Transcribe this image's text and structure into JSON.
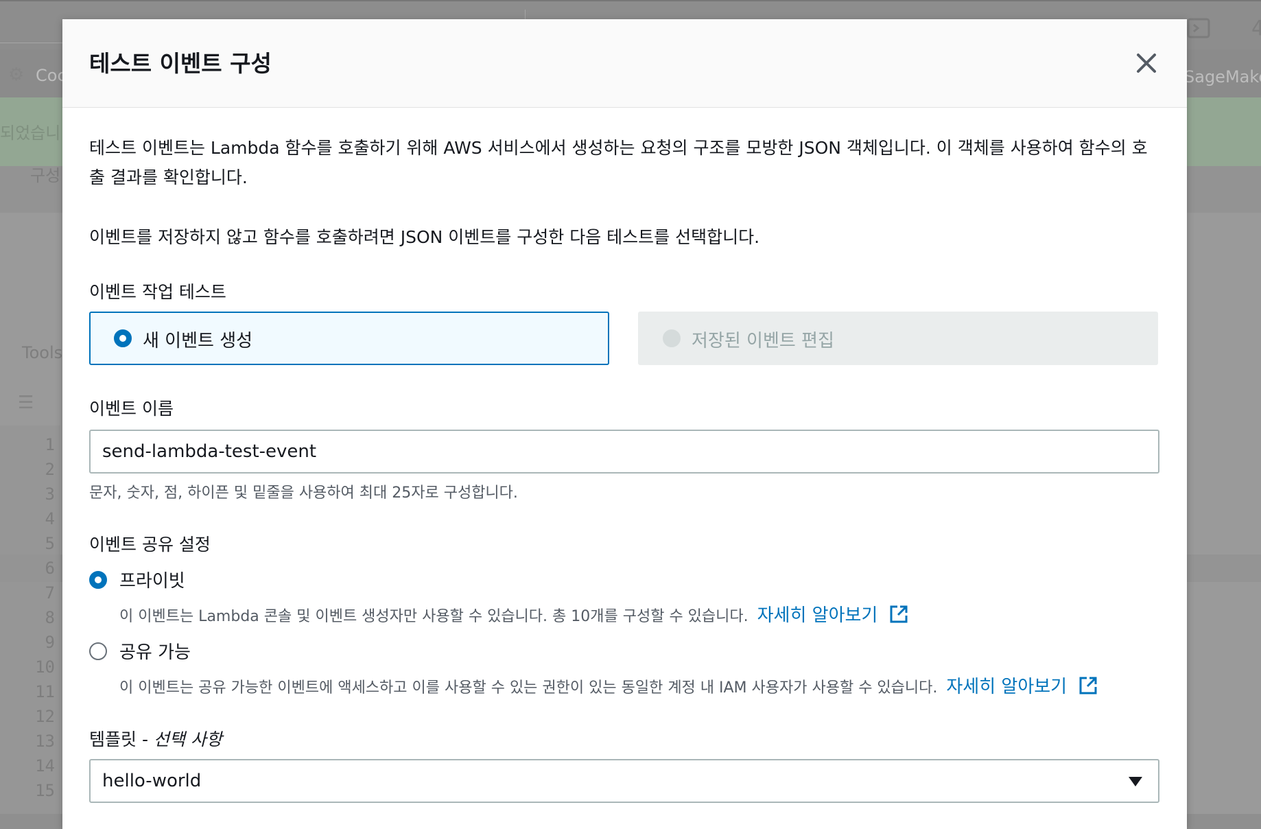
{
  "background": {
    "nav_left": "Coc",
    "nav_right": "SageMake",
    "banner_fragment": "되었습니",
    "tab_fragment": "구성",
    "tools_label": "Tools",
    "line_numbers": [
      "1",
      "2",
      "3",
      "4",
      "5",
      "6",
      "7",
      "8",
      "9",
      "10",
      "11",
      "12",
      "13",
      "14",
      "15"
    ],
    "top_right_fragment": "4"
  },
  "modal": {
    "title": "테스트 이벤트 구성",
    "intro": "테스트 이벤트는 Lambda 함수를 호출하기 위해 AWS 서비스에서 생성하는 요청의 구조를 모방한 JSON 객체입니다. 이 객체를 사용하여 함수의 호출 결과를 확인합니다.",
    "instruction": "이벤트를 저장하지 않고 함수를 호출하려면 JSON 이벤트를 구성한 다음 테스트를 선택합니다.",
    "action_label": "이벤트 작업 테스트",
    "action_options": [
      {
        "label": "새 이벤트 생성",
        "selected": true
      },
      {
        "label": "저장된 이벤트 편집",
        "selected": false,
        "disabled": true
      }
    ],
    "event_name_label": "이벤트 이름",
    "event_name_value": "send-lambda-test-event",
    "event_name_hint": "문자, 숫자, 점, 하이픈 및 밑줄을 사용하여 최대 25자로 구성합니다.",
    "sharing_label": "이벤트 공유 설정",
    "sharing_options": [
      {
        "label": "프라이빗",
        "selected": true,
        "description": "이 이벤트는 Lambda 콘솔 및 이벤트 생성자만 사용할 수 있습니다. 총 10개를 구성할 수 있습니다.",
        "link": "자세히 알아보기"
      },
      {
        "label": "공유 가능",
        "selected": false,
        "description": "이 이벤트는 공유 가능한 이벤트에 액세스하고 이를 사용할 수 있는 권한이 있는 동일한 계정 내 IAM 사용자가 사용할 수 있습니다.",
        "link": "자세히 알아보기"
      }
    ],
    "template_label": "템플릿 - ",
    "template_optional": "선택 사항",
    "template_value": "hello-world"
  },
  "colors": {
    "accent": "#0073bb",
    "text": "#16191f",
    "muted": "#545b64"
  },
  "icons": {
    "close": "close-icon",
    "external": "external-link-icon",
    "dropdown": "caret-down-icon"
  }
}
